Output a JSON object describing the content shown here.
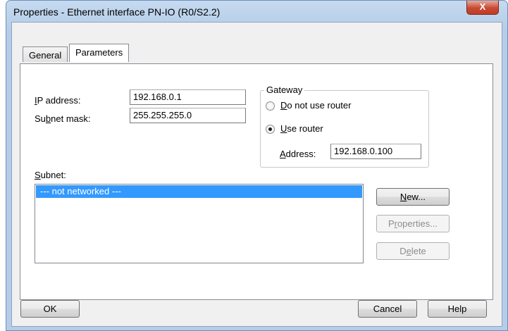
{
  "window": {
    "title": "Properties - Ethernet interface  PN-IO (R0/S2.2)",
    "close_glyph": "X"
  },
  "tabs": [
    {
      "label": "General",
      "active": false
    },
    {
      "label": "Parameters",
      "active": true
    }
  ],
  "parameters": {
    "ip_address": {
      "label_pre": "",
      "label_ul": "I",
      "label_post": "P address:",
      "value": "192.168.0.1"
    },
    "subnet_mask": {
      "label_pre": "Su",
      "label_ul": "b",
      "label_post": "net mask:",
      "value": "255.255.255.0"
    }
  },
  "gateway": {
    "legend": "Gateway",
    "do_not_use": {
      "label_pre": "",
      "label_ul": "D",
      "label_post": "o not use router",
      "checked": false
    },
    "use_router": {
      "label_pre": "",
      "label_ul": "U",
      "label_post": "se router",
      "checked": true
    },
    "address": {
      "label_pre": "",
      "label_ul": "A",
      "label_post": "ddress:",
      "value": "192.168.0.100"
    }
  },
  "subnet": {
    "label_ul": "S",
    "label_post": "ubnet:",
    "items": [
      "--- not networked ---"
    ],
    "selected_index": 0
  },
  "subnet_buttons": {
    "new": {
      "label_ul": "N",
      "label_post": "ew...",
      "enabled": true
    },
    "properties": {
      "label_pre": "P",
      "label_ul": "r",
      "label_post": "operties...",
      "enabled": false
    },
    "delete": {
      "label_pre": "D",
      "label_ul": "e",
      "label_post": "lete",
      "enabled": false
    }
  },
  "footer": {
    "ok": "OK",
    "cancel": "Cancel",
    "help": "Help"
  },
  "colors": {
    "selection": "#3399ff",
    "close_button": "#c74a34"
  }
}
